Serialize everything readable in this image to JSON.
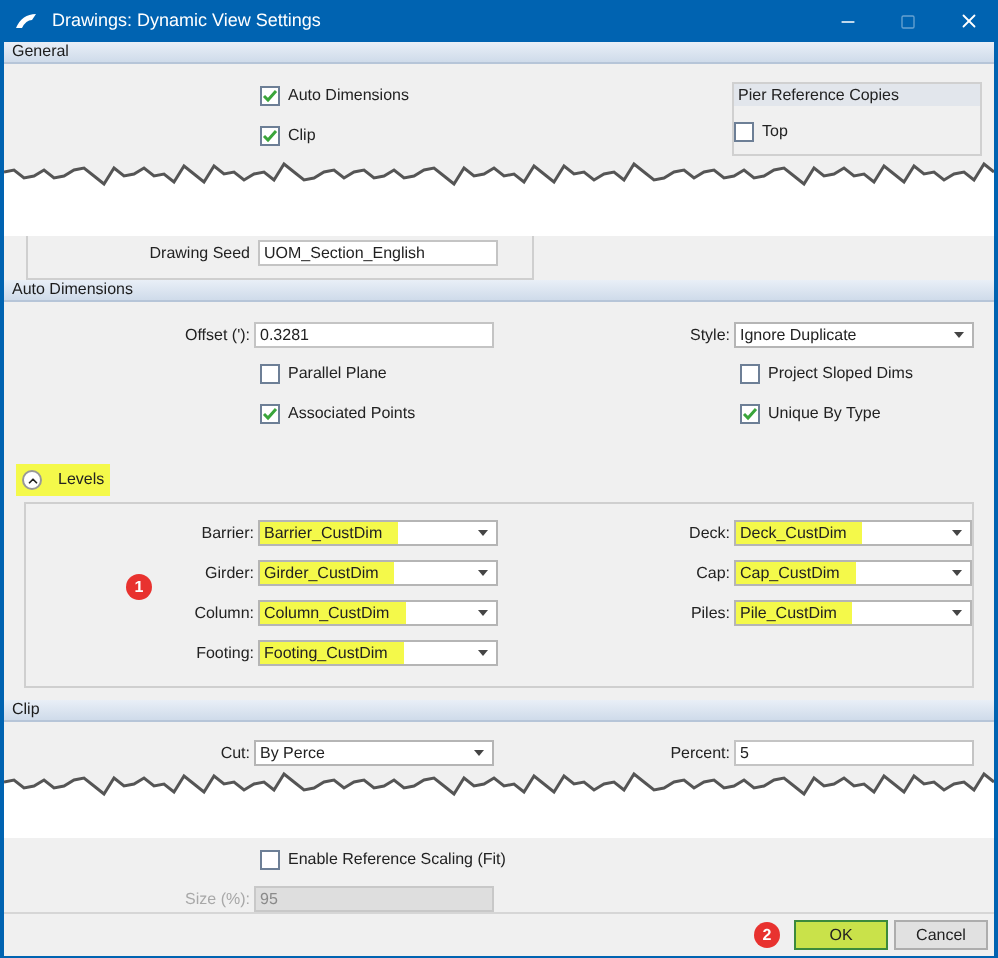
{
  "window": {
    "title": "Drawings: Dynamic View Settings"
  },
  "general": {
    "header": "General",
    "checkboxes": [
      {
        "label": "Auto Dimensions",
        "checked": true
      },
      {
        "label": "Clip",
        "checked": true
      }
    ],
    "pier_reference_copies": {
      "title": "Pier Reference Copies",
      "checkboxes": [
        {
          "label": "Top",
          "checked": false
        }
      ]
    },
    "seed": {
      "label": "Drawing Seed",
      "value": "UOM_Section_English"
    }
  },
  "auto_dimensions": {
    "header": "Auto Dimensions",
    "offset": {
      "label": "Offset ('):",
      "value": "0.3281"
    },
    "style": {
      "label": "Style:",
      "value": "Ignore Duplicate"
    },
    "left_checkboxes": [
      {
        "label": "Parallel Plane",
        "checked": false
      },
      {
        "label": "Associated Points",
        "checked": true
      }
    ],
    "right_checkboxes": [
      {
        "label": "Project Sloped Dims",
        "checked": false
      },
      {
        "label": "Unique By Type",
        "checked": true
      }
    ],
    "levels": {
      "label": "Levels",
      "expanded": true,
      "highlighted": true,
      "callout": "1",
      "left_fields": [
        {
          "label": "Barrier:",
          "value": "Barrier_CustDim",
          "highlighted": true
        },
        {
          "label": "Girder:",
          "value": "Girder_CustDim",
          "highlighted": true
        },
        {
          "label": "Column:",
          "value": "Column_CustDim",
          "highlighted": true
        },
        {
          "label": "Footing:",
          "value": "Footing_CustDim",
          "highlighted": true
        }
      ],
      "right_fields": [
        {
          "label": "Deck:",
          "value": "Deck_CustDim",
          "highlighted": true
        },
        {
          "label": "Cap:",
          "value": "Cap_CustDim",
          "highlighted": true
        },
        {
          "label": "Piles:",
          "value": "Pile_CustDim",
          "highlighted": true
        }
      ]
    }
  },
  "clip": {
    "header": "Clip",
    "cut": {
      "label": "Cut:",
      "value": "By Perce"
    },
    "percent": {
      "label": "Percent:",
      "value": "5"
    },
    "checkboxes": [
      {
        "label": "Enable Reference Scaling (Fit)",
        "checked": false
      }
    ],
    "size": {
      "label": "Size (%):",
      "value": "95",
      "disabled": true
    }
  },
  "footer": {
    "callout": "2",
    "buttons": [
      {
        "label": "OK",
        "highlighted": true
      },
      {
        "label": "Cancel",
        "highlighted": false
      }
    ]
  }
}
